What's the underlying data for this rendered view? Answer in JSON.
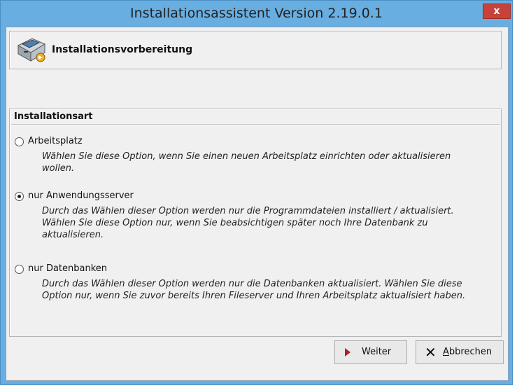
{
  "window": {
    "title": "Installationsassistent  Version 2.19.0.1",
    "close_label": "x"
  },
  "header": {
    "icon": "installer-computer-icon",
    "title": "Installationsvorbereitung"
  },
  "group": {
    "title": "Installationsart",
    "options": [
      {
        "label": "Arbeitsplatz",
        "checked": false,
        "description": "Wählen Sie diese Option, wenn Sie einen neuen Arbeitsplatz einrichten oder aktualisieren wollen."
      },
      {
        "label": "nur Anwendungsserver",
        "checked": true,
        "description": "Durch das Wählen dieser Option werden nur die Programmdateien installiert / aktualisiert. Wählen Sie diese Option nur, wenn Sie beabsichtigen später noch Ihre Datenbank zu aktualisieren."
      },
      {
        "label": "nur Datenbanken",
        "checked": false,
        "description": "Durch das Wählen dieser Option werden nur die Datenbanken aktualisiert. Wählen Sie diese Option nur, wenn Sie zuvor bereits Ihren Fileserver und Ihren Arbeitsplatz aktualisiert haben."
      }
    ]
  },
  "buttons": {
    "next_label": "Weiter",
    "next_icon": "play-arrow-icon",
    "cancel_mnemonic": "A",
    "cancel_rest": "bbrechen",
    "cancel_icon": "x-icon"
  },
  "colors": {
    "title_bar": "#68aee1",
    "close_button": "#c8423a",
    "dialog_background": "#f0f0f0",
    "next_arrow": "#b02020"
  }
}
